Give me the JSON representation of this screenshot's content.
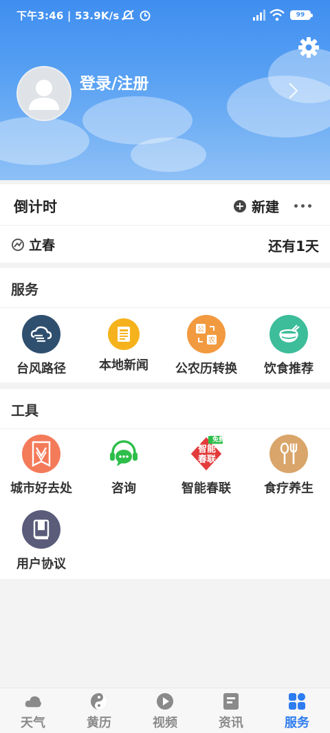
{
  "status_bar": {
    "time_network": "下午3:46 | 53.9K/s",
    "battery": "99"
  },
  "profile": {
    "login_label": "登录/注册"
  },
  "countdown": {
    "title": "倒计时",
    "new_label": "新建",
    "term_name": "立春",
    "term_remaining": "还有1天"
  },
  "services": {
    "title": "服务",
    "items": [
      {
        "label": "台风路径",
        "icon": "typhoon-icon",
        "color": "#2f4f6e"
      },
      {
        "label": "本地新闻",
        "icon": "news-icon",
        "color": "#f5b21c"
      },
      {
        "label": "公农历转换",
        "icon": "calendar-convert-icon",
        "color": "#f29a3f"
      },
      {
        "label": "饮食推荐",
        "icon": "food-bowl-icon",
        "color": "#3dbd9a"
      }
    ]
  },
  "tools": {
    "title": "工具",
    "items": [
      {
        "label": "城市好去处",
        "icon": "city-places-icon",
        "color": "#f47b5a"
      },
      {
        "label": "咨询",
        "icon": "chat-headset-icon",
        "color": "#2dbe4a"
      },
      {
        "label": "智能春联",
        "icon": "couplet-icon",
        "color": "#e33b3b",
        "badge": "免费",
        "icon_text_1": "智能",
        "icon_text_2": "春联"
      },
      {
        "label": "食疗养生",
        "icon": "spoon-fork-icon",
        "color": "#d9a56a"
      },
      {
        "label": "用户协议",
        "icon": "agreement-book-icon",
        "color": "#5a5c7a"
      }
    ]
  },
  "bottom_nav": [
    {
      "label": "天气",
      "icon": "weather-icon"
    },
    {
      "label": "黄历",
      "icon": "almanac-icon"
    },
    {
      "label": "视频",
      "icon": "video-icon"
    },
    {
      "label": "资讯",
      "icon": "news-tab-icon"
    },
    {
      "label": "服务",
      "icon": "services-icon",
      "active": true
    }
  ],
  "colors": {
    "accent": "#2d7cf0",
    "header_top": "#3f8ef0"
  }
}
